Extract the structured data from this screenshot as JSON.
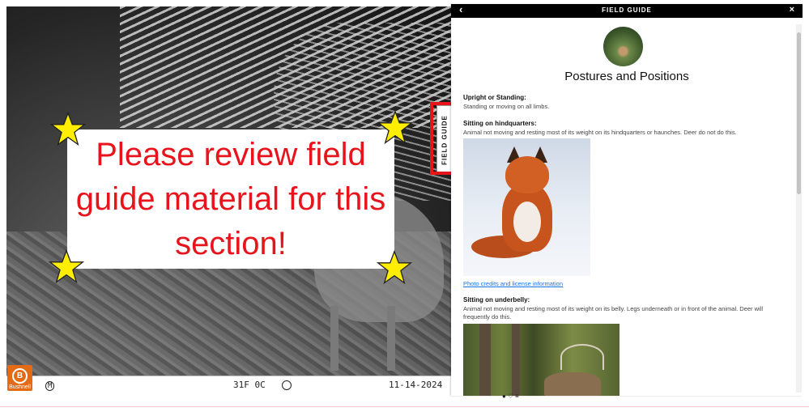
{
  "notice": {
    "text": "Please review field guide material for this section!"
  },
  "camera": {
    "brand": "Bushnell",
    "brand_initial": "B",
    "icon_m": "M",
    "temperature": "31F 0C",
    "date": "11-14-2024"
  },
  "tab": {
    "label": "FIELD GUIDE"
  },
  "panel": {
    "header_title": "FIELD GUIDE",
    "back_icon": "‹",
    "close_icon": "×",
    "title": "Postures and Positions",
    "sections": [
      {
        "title": "Upright or Standing:",
        "text": "Standing or moving on all limbs."
      },
      {
        "title": "Sitting on hindquarters:",
        "text": "Animal not moving and resting most of its weight on its hindquarters or haunches. Deer do not do this."
      },
      {
        "title": "Sitting on underbelly:",
        "text": "Animal not moving and resting most of its weight on its belly. Legs underneath or in front of the animal. Deer will frequently do this."
      }
    ],
    "credits_link": "Photo credits and license information"
  },
  "colors": {
    "notice_text": "#e8141c",
    "highlight": "#e8141c",
    "header_bg": "#000000",
    "link": "#1a73e8"
  }
}
